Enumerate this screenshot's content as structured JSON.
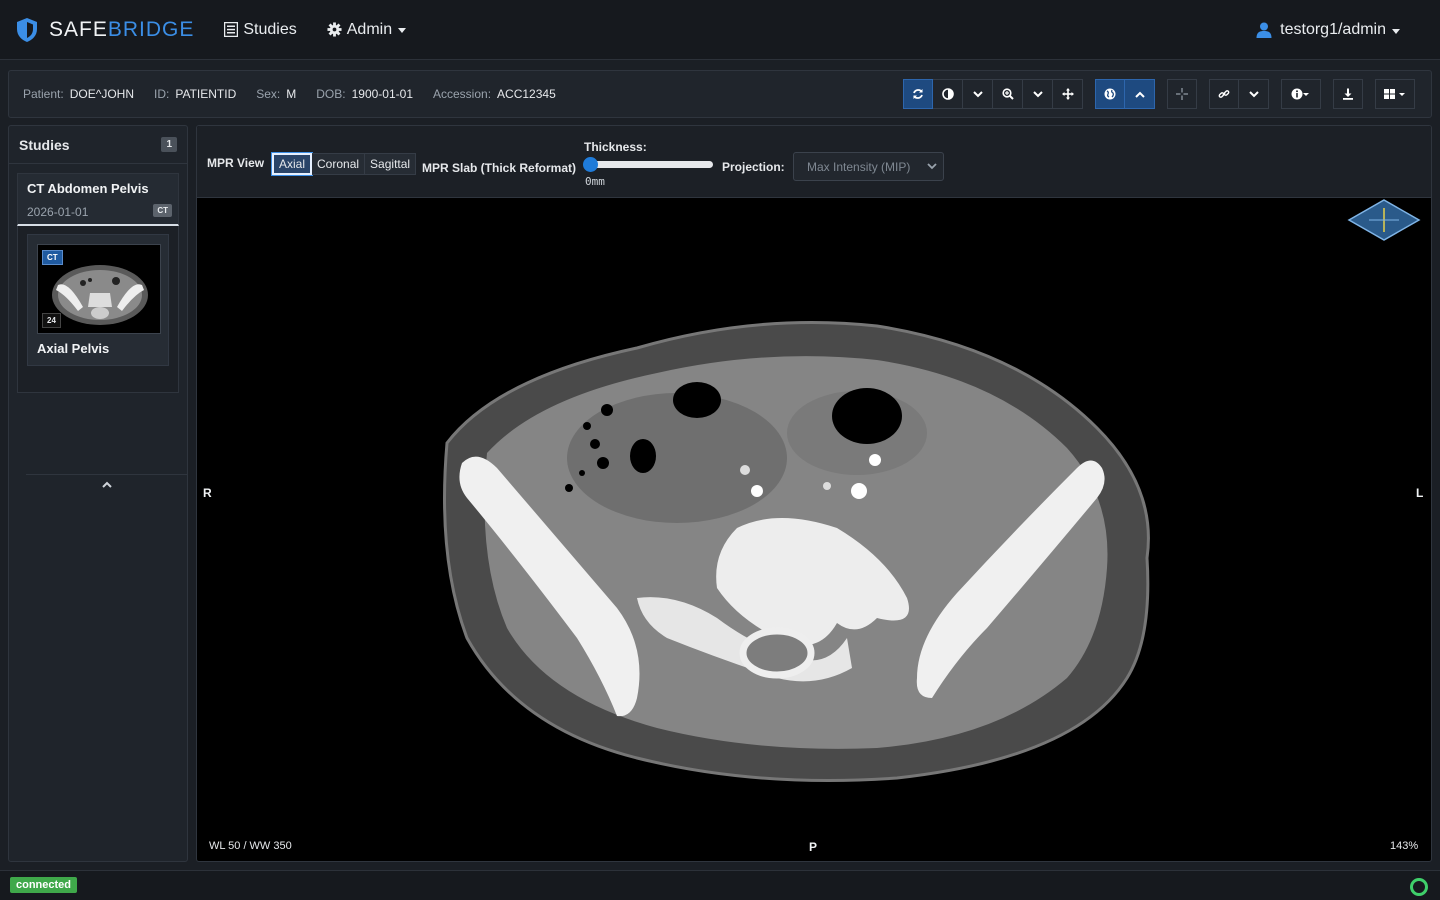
{
  "brand": {
    "part1": "SAFE",
    "part2": "BRIDGE"
  },
  "nav": {
    "studies_label": "Studies",
    "admin_label": "Admin",
    "user_label": "testorg1/admin"
  },
  "patient": {
    "patient_key": "Patient:",
    "patient_val": "DOE^JOHN",
    "id_key": "ID:",
    "id_val": "PATIENTID",
    "sex_key": "Sex:",
    "sex_val": "M",
    "dob_key": "DOB:",
    "dob_val": "1900-01-01",
    "accession_key": "Accession:",
    "accession_val": "ACC12345"
  },
  "toolbar": {
    "icons": [
      "reset-icon",
      "contrast-icon",
      "zoom-icon",
      "pan-icon",
      "3d-globe-icon",
      "crosshair-icon",
      "link-icon",
      "info-icon",
      "download-icon",
      "layout-grid-icon"
    ],
    "active_color": "#1e4a80"
  },
  "sidebar": {
    "title": "Studies",
    "count": "1",
    "study": {
      "name": "CT Abdomen Pelvis",
      "date": "2026-01-01",
      "modality": "CT"
    },
    "series": {
      "modality": "CT",
      "count": "24",
      "name": "Axial Pelvis"
    }
  },
  "mpr": {
    "view_label": "MPR View",
    "views": [
      "Axial",
      "Coronal",
      "Sagittal"
    ],
    "active_view": "Axial",
    "slab_label": "MPR Slab (Thick Reformat)",
    "thickness_label": "Thickness:",
    "thickness_value": "0mm",
    "thickness_fraction": 0,
    "projection_label": "Projection:",
    "projection_value": "Max Intensity (MIP)"
  },
  "viewport": {
    "orient_left": "R",
    "orient_right": "L",
    "orient_bottom": "P",
    "window_level": "WL 50 / WW 350",
    "zoom": "143%"
  },
  "status": {
    "connection": "connected",
    "connection_color": "#3fa84a"
  }
}
